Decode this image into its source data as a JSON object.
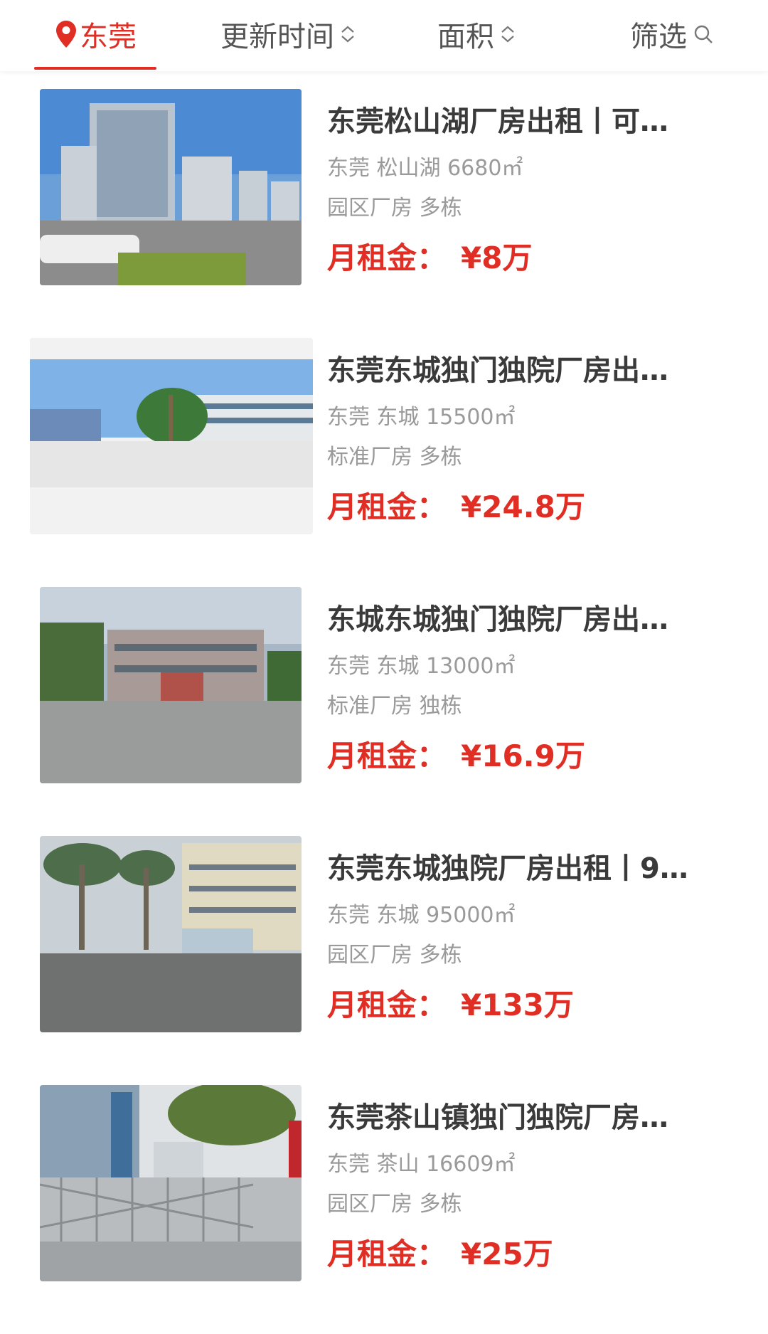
{
  "filters": {
    "location": "东莞",
    "update_time": "更新时间",
    "area": "面积",
    "filter": "筛选"
  },
  "colors": {
    "accent": "#e02e24"
  },
  "rent_label": "月租金：",
  "listings": [
    {
      "title": "东莞松山湖厂房出租丨可…",
      "meta": "东莞 松山湖 6680㎡",
      "tags": "园区厂房 多栋",
      "price": "¥8万",
      "image": "office-park-photo"
    },
    {
      "title": "东莞东城独门独院厂房出…",
      "meta": "东莞 东城 15500㎡",
      "tags": "标准厂房 多栋",
      "price": "¥24.8万",
      "image": "factory-palm-trees-photo"
    },
    {
      "title": "东城东城独门独院厂房出…",
      "meta": "东莞 东城 13000㎡",
      "tags": "标准厂房 独栋",
      "price": "¥16.9万",
      "image": "factory-courtyard-photo"
    },
    {
      "title": "东莞东城独院厂房出租丨9…",
      "meta": "东莞 东城 95000㎡",
      "tags": "园区厂房 多栋",
      "price": "¥133万",
      "image": "factory-gate-palms-photo"
    },
    {
      "title": "东莞茶山镇独门独院厂房…",
      "meta": "东莞 茶山 16609㎡",
      "tags": "园区厂房 多栋",
      "price": "¥25万",
      "image": "factory-sliding-gate-photo"
    }
  ]
}
